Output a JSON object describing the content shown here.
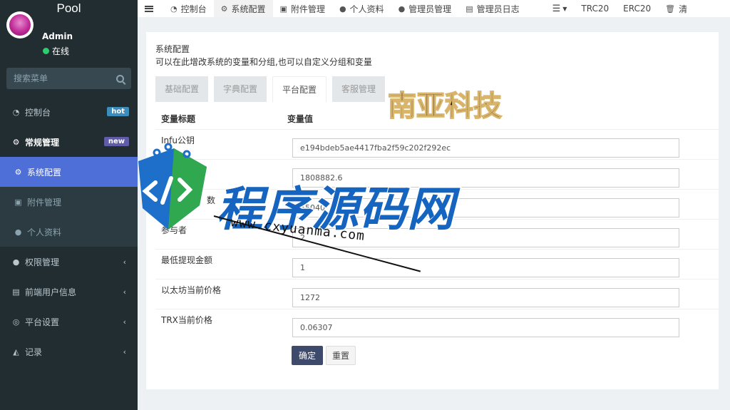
{
  "app": {
    "title": "Pool"
  },
  "user": {
    "name": "Admin",
    "status": "在线"
  },
  "search": {
    "placeholder": "搜索菜单"
  },
  "sidebar": {
    "items": [
      {
        "label": "控制台",
        "badge": "hot"
      },
      {
        "label": "常规管理",
        "badge": "new"
      },
      {
        "label": "系统配置"
      },
      {
        "label": "附件管理"
      },
      {
        "label": "个人资料"
      },
      {
        "label": "权限管理"
      },
      {
        "label": "前端用户信息"
      },
      {
        "label": "平台设置"
      },
      {
        "label": "记录"
      }
    ]
  },
  "navbar": {
    "items": [
      {
        "label": "控制台"
      },
      {
        "label": "系统配置"
      },
      {
        "label": "附件管理"
      },
      {
        "label": "个人资料"
      },
      {
        "label": "管理员管理"
      },
      {
        "label": "管理员日志"
      }
    ],
    "right": [
      {
        "label": "TRC20"
      },
      {
        "label": "ERC20"
      },
      {
        "label": "清"
      }
    ]
  },
  "page": {
    "title": "系统配置",
    "description": "可以在此增改系统的变量和分组,也可以自定义分组和变量"
  },
  "tabs": [
    {
      "label": "基础配置"
    },
    {
      "label": "字典配置"
    },
    {
      "label": "平台配置"
    },
    {
      "label": "客服管理"
    }
  ],
  "table": {
    "headers": {
      "title": "变量标题",
      "value": "变量值"
    },
    "rows": [
      {
        "label": "Infu公钥",
        "value": "e194bdeb5ae4417fba2f59c202f292ec"
      },
      {
        "label": "",
        "value": "1808882.6"
      },
      {
        "label": "数",
        "value": "55040"
      },
      {
        "label": "参与者",
        "value": "2"
      },
      {
        "label": "最低提现金额",
        "value": "1"
      },
      {
        "label": "以太坊当前价格",
        "value": "1272"
      },
      {
        "label": "TRX当前价格",
        "value": "0.06307"
      }
    ]
  },
  "buttons": {
    "confirm": "确定",
    "reset": "重置"
  },
  "watermarks": {
    "logo_text": "南亚科技",
    "big_text": "程序源码网",
    "url": "www.cxyuanma.com"
  },
  "colors": {
    "sidebar_bg": "#222d32",
    "active_menu": "#4e6ed8",
    "confirm_button": "#3d4a6b",
    "watermark_blue": "#1565c0"
  }
}
